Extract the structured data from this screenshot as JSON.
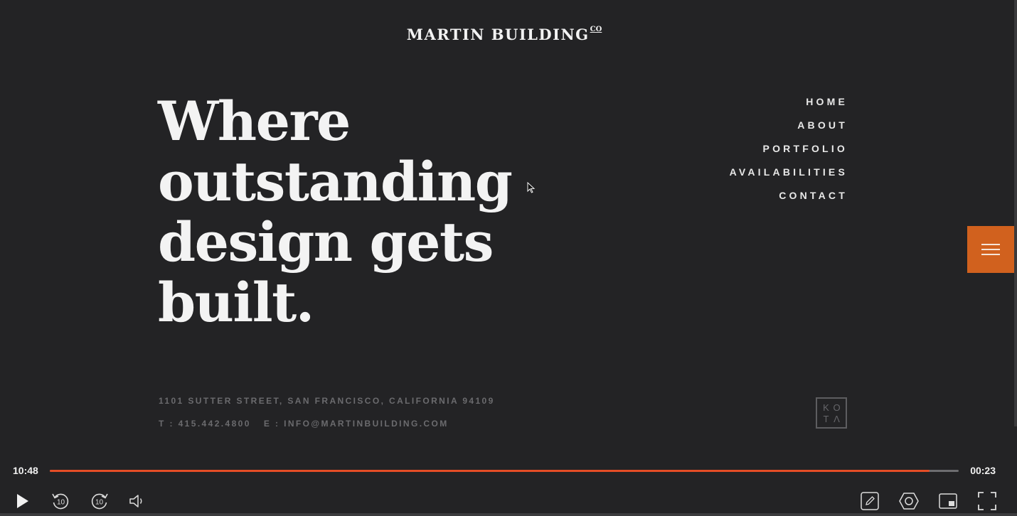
{
  "site": {
    "logo": "MARTIN BUILDING",
    "logo_sup": "CO",
    "headline": "Where outstanding design gets built."
  },
  "nav": {
    "items": [
      "HOME",
      "ABOUT",
      "PORTFOLIO",
      "AVAILABILITIES",
      "CONTACT"
    ]
  },
  "footer": {
    "address": "1101 SUTTER STREET, SAN FRANCISCO, CALIFORNIA 94109",
    "phone": "T : 415.442.4800",
    "email": "E : INFO@MARTINBUILDING.COM",
    "partner_logo": [
      "K",
      "O",
      "T",
      "Λ"
    ]
  },
  "player": {
    "elapsed": "10:48",
    "remaining": "00:23",
    "progress_fraction": 0.968,
    "skip_back_label": "10",
    "skip_forward_label": "10",
    "accent_color": "#e44d26"
  },
  "colors": {
    "background": "#232325",
    "menu_button": "#d1611e"
  },
  "icons": {
    "menu": "hamburger-icon",
    "play": "play-icon",
    "rewind": "rewind-10-icon",
    "forward": "forward-10-icon",
    "volume": "volume-icon",
    "annotate": "pencil-icon",
    "settings": "settings-icon",
    "pip": "picture-in-picture-icon",
    "fullscreen": "fullscreen-icon"
  }
}
